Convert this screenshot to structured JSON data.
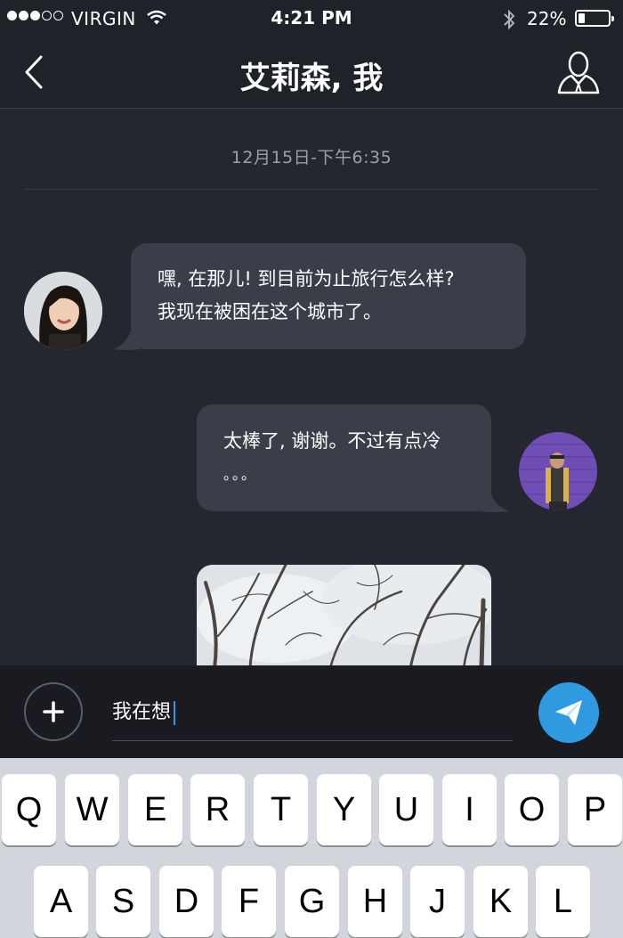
{
  "status_bar": {
    "carrier": "VIRGIN",
    "time": "4:21 PM",
    "battery": "22%",
    "battery_level": 0.22
  },
  "nav": {
    "title": "艾莉森, 我",
    "back_icon": "chevron-left-icon",
    "profile_icon": "person-icon"
  },
  "chat": {
    "timestamp": "12月15日-下午6:35",
    "messages": [
      {
        "from": "contact",
        "lines": [
          "嘿, 在那儿! 到目前为止旅行怎么样?",
          "我现在被困在这个城市了。"
        ]
      },
      {
        "from": "me",
        "lines": [
          "太棒了, 谢谢。不过有点冷",
          "。。。"
        ]
      },
      {
        "from": "me",
        "type": "photo",
        "description_icon": "winter-trees-photo"
      }
    ]
  },
  "composer": {
    "input_value": "我在想",
    "add_icon": "plus-icon",
    "send_icon": "paper-plane-icon"
  },
  "keyboard": {
    "row1": [
      "Q",
      "W",
      "E",
      "R",
      "T",
      "Y",
      "U",
      "I",
      "O",
      "P"
    ],
    "row2": [
      "A",
      "S",
      "D",
      "F",
      "G",
      "H",
      "J",
      "K",
      "L"
    ]
  },
  "colors": {
    "background": "#24272f",
    "bar": "#1f2229",
    "bubble": "#3a3e48",
    "accent": "#2f9ae0",
    "keyboard": "#d2d5db"
  }
}
